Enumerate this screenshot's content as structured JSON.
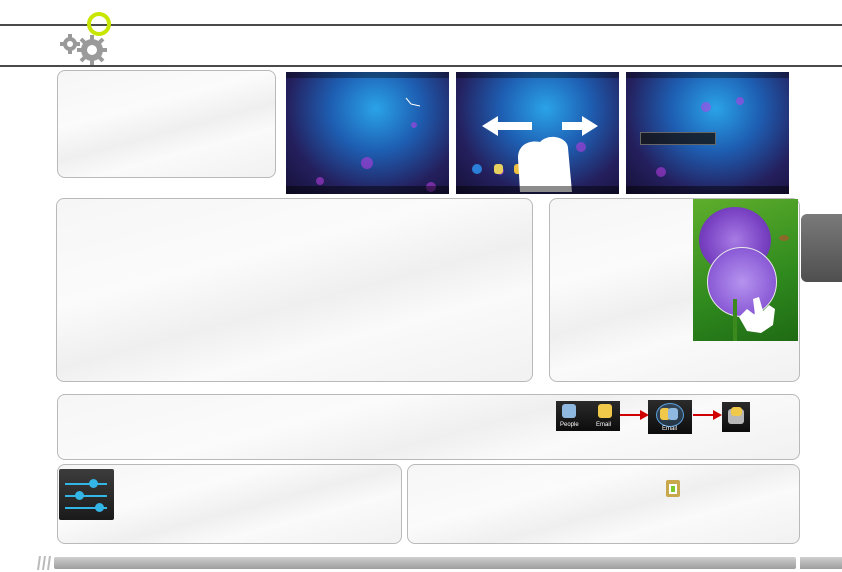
{
  "header": {
    "logo_icon": "gears-icon"
  },
  "screenshots": [
    {
      "name": "home-screen",
      "clock": true
    },
    {
      "name": "swipe-gesture",
      "gesture": "swipe-horizontal-icon"
    },
    {
      "name": "quick-settings",
      "gesture": "none"
    }
  ],
  "zoom_panel": {
    "photo": "purple-allium-flower",
    "gesture": "pinch-zoom-hand-icon"
  },
  "folder_strip": {
    "labels": {
      "people": "People",
      "email": "Email",
      "folder": "Email"
    }
  },
  "settings_panel": {
    "icon": "settings-sliders-icon"
  },
  "store_panel": {
    "icon": "app-store-bag-icon"
  },
  "side_tab": {
    "color": "#5e5e5e"
  },
  "colors": {
    "rule": "#4a4a4a",
    "arrow": "#d00000",
    "accent": "#c8e600"
  }
}
